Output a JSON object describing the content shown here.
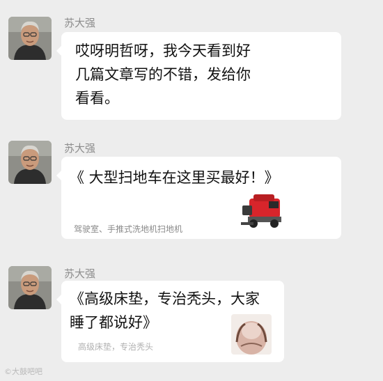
{
  "messages": [
    {
      "sender": "苏大强",
      "text_lines": [
        "哎呀明哲呀，我今天看到好",
        "几篇文章写的不错，发给你",
        "看看。"
      ]
    },
    {
      "sender": "苏大强",
      "card_title": "《 大型扫地车在这里买最好！》",
      "card_subtitle": "驾驶室、手推式洗地机扫地机",
      "thumb_icon": "red-sweeper-vehicle-icon"
    },
    {
      "sender": "苏大强",
      "card_title_lines": [
        "《高级床垫，专治秃头，大家",
        "睡了都说好》"
      ],
      "card_subtitle": "高级床垫，专治秃头",
      "thumb_icon": "bald-head-photo-icon"
    }
  ],
  "watermark": "©大鼓吧吧",
  "colors": {
    "background": "#ededed",
    "bubble": "#ffffff",
    "sweeper_red": "#d8252b"
  }
}
